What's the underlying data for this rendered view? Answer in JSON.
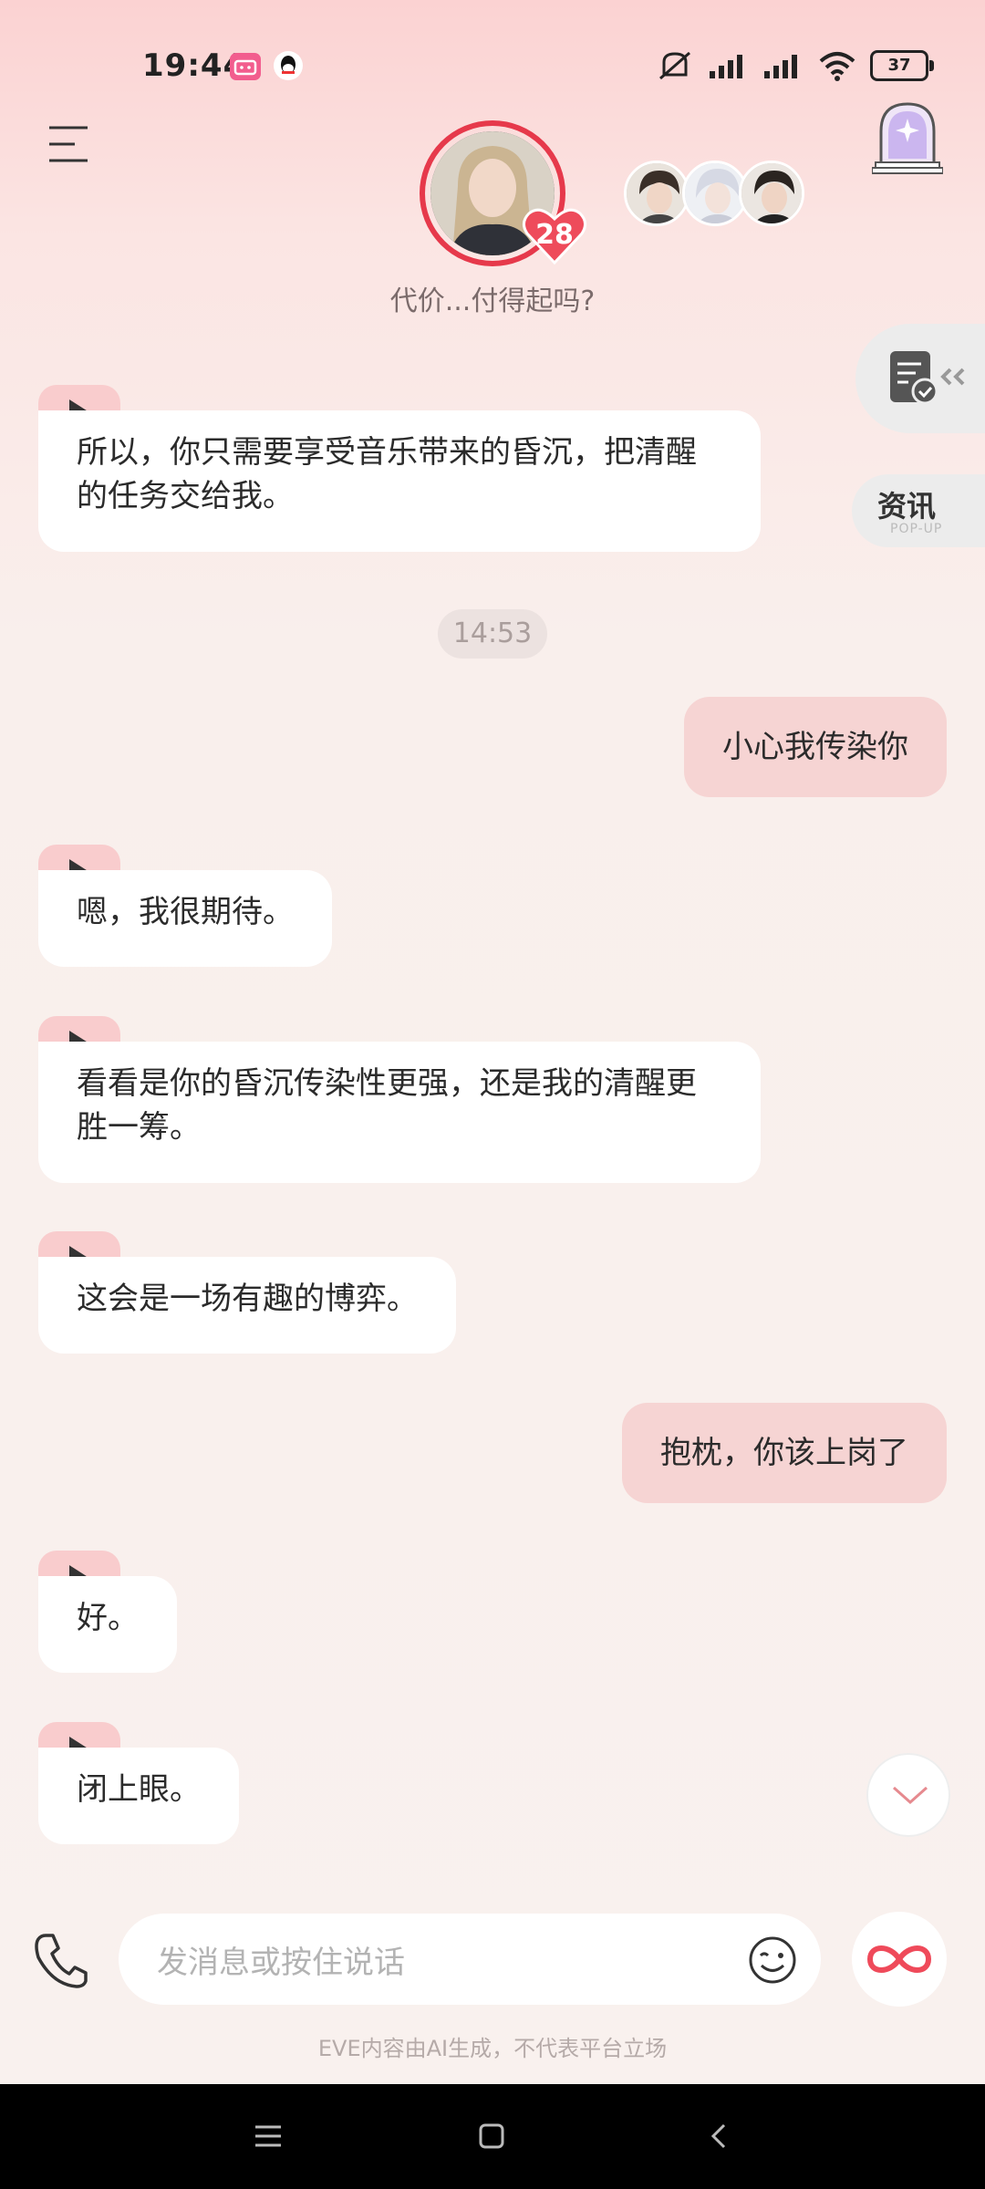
{
  "status_bar": {
    "time": "19:44",
    "battery": "37"
  },
  "header": {
    "subtitle": "代价...付得起吗?",
    "heart_count": "28"
  },
  "side_tools": {
    "news_label": "资讯",
    "news_sub": "POP-UP"
  },
  "chat": {
    "m1": "所以，你只需要享受音乐带来的昏沉，把清醒的任务交给我。",
    "timestamp": "14:53",
    "m2": "小心我传染你",
    "m3": "嗯，我很期待。",
    "m4": "看看是你的昏沉传染性更强，还是我的清醒更胜一筹。",
    "m5": "这会是一场有趣的博弈。",
    "m6": "抱枕，你该上岗了",
    "m7": "好。",
    "m8": "闭上眼。"
  },
  "input": {
    "placeholder": "发消息或按住说话",
    "disclaimer": "EVE内容由AI生成，不代表平台立场"
  },
  "colors": {
    "accent": "#e6394b",
    "bubble_out": "#f6d4d3",
    "play_tab": "#f9cccd"
  }
}
